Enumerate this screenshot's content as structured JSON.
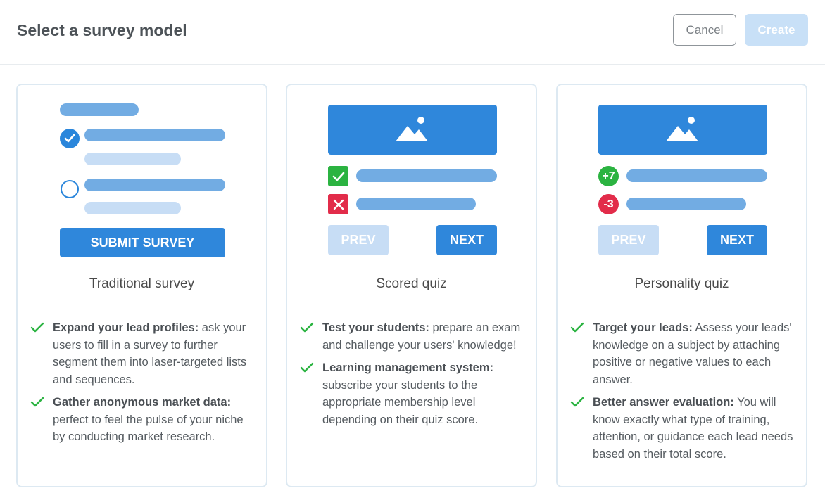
{
  "header": {
    "title": "Select a survey model",
    "cancel_label": "Cancel",
    "create_label": "Create"
  },
  "colors": {
    "accent": "#2f87db",
    "accent_light": "#c7ddf5",
    "success": "#2bb341",
    "danger": "#e22c4a",
    "card_border": "#dde9f2"
  },
  "cards": [
    {
      "name": "Traditional survey",
      "illustration": {
        "submit_label": "SUBMIT SURVEY",
        "icons": [
          "radio-checked-icon",
          "radio-empty-icon"
        ]
      },
      "features": [
        {
          "bold": "Expand your lead profiles:",
          "text": " ask your users to fill in a survey to further segment them into laser-targeted lists and sequences."
        },
        {
          "bold": "Gather anonymous market data:",
          "text": " perfect to feel the pulse of your niche by conducting market research."
        }
      ]
    },
    {
      "name": "Scored quiz",
      "illustration": {
        "prev_label": "PREV",
        "next_label": "NEXT",
        "icons": [
          "image-placeholder-icon",
          "checkmark-icon",
          "cross-icon"
        ]
      },
      "features": [
        {
          "bold": "Test your students:",
          "text": " prepare an exam and challenge your users' knowledge!"
        },
        {
          "bold": "Learning management system:",
          "text": " subscribe your students to the appropriate membership level depending on their quiz score."
        }
      ]
    },
    {
      "name": "Personality quiz",
      "illustration": {
        "prev_label": "PREV",
        "next_label": "NEXT",
        "positive_score": "+7",
        "negative_score": "-3",
        "icons": [
          "image-placeholder-icon"
        ]
      },
      "features": [
        {
          "bold": "Target your leads:",
          "text": " Assess your leads' knowledge on a subject by attaching positive or negative values to each answer."
        },
        {
          "bold": "Better answer evaluation:",
          "text": " You will know exactly what type of training, attention, or guidance each lead needs based on their total score."
        }
      ]
    }
  ]
}
